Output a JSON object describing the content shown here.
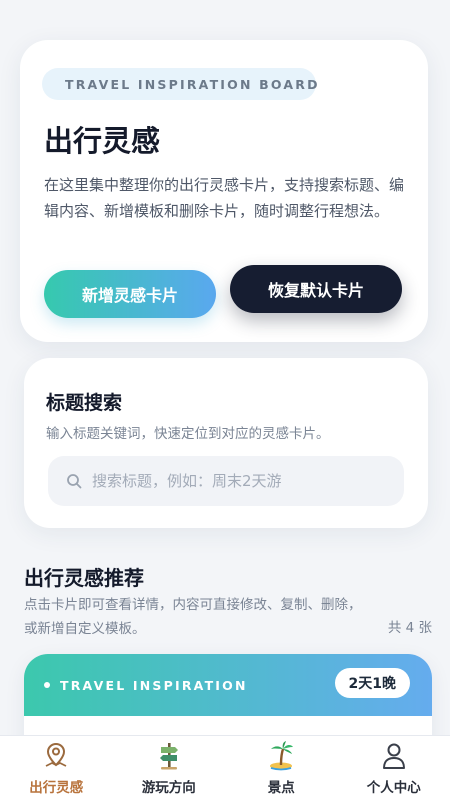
{
  "hero": {
    "badge": "TRAVEL INSPIRATION BOARD",
    "title": "出行灵感",
    "description": "在这里集中整理你的出行灵感卡片，支持搜索标题、编辑内容、新增模板和删除卡片，随时调整行程想法。",
    "add_button": "新增灵感卡片",
    "reset_button": "恢复默认卡片"
  },
  "search": {
    "title": "标题搜索",
    "subtitle": "输入标题关键词，快速定位到对应的灵感卡片。",
    "placeholder": "搜索标题，例如：周末2天游"
  },
  "list": {
    "title": "出行灵感推荐",
    "description": "点击卡片即可查看详情，内容可直接修改、复制、删除，或新增自定义模板。",
    "count": "共 4 张",
    "cards": [
      {
        "label": "TRAVEL INSPIRATION",
        "duration": "2天1晚"
      }
    ]
  },
  "tabbar": {
    "items": [
      {
        "label": "出行灵感",
        "icon": "map-pin-icon",
        "active": true
      },
      {
        "label": "游玩方向",
        "icon": "signpost-icon",
        "active": false
      },
      {
        "label": "景点",
        "icon": "palm-tree-icon",
        "active": false
      },
      {
        "label": "个人中心",
        "icon": "user-icon",
        "active": false
      }
    ]
  },
  "colors": {
    "accent_gradient_start": "#36c9ae",
    "accent_gradient_end": "#5aa8ef",
    "dark_button": "#161d31",
    "active_tab": "#b8733c"
  }
}
